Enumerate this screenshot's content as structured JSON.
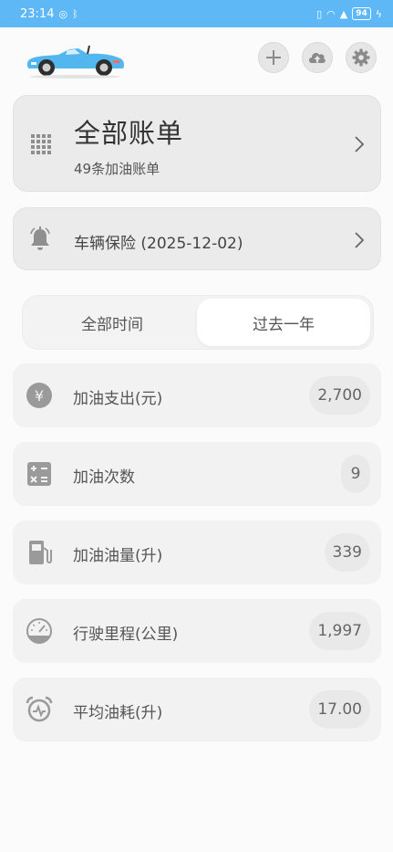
{
  "status_bar": {
    "time": "23:14",
    "battery": "94"
  },
  "header": {
    "logo_icon": "convertible-car-icon",
    "add_icon": "plus-icon",
    "upload_icon": "cloud-upload-icon",
    "settings_icon": "gear-icon"
  },
  "all_bills": {
    "title": "全部账单",
    "subtitle": "49条加油账单"
  },
  "insurance": {
    "label": "车辆保险 (2025-12-02)"
  },
  "tabs": {
    "all_time": "全部时间",
    "past_year": "过去一年",
    "selected": "past_year"
  },
  "stats": [
    {
      "label": "加油支出(元)",
      "value": "2,700",
      "icon": "yen-coin-icon"
    },
    {
      "label": "加油次数",
      "value": "9",
      "icon": "calculator-icon"
    },
    {
      "label": "加油油量(升)",
      "value": "339",
      "icon": "fuel-pump-icon"
    },
    {
      "label": "行驶里程(公里)",
      "value": "1,997",
      "icon": "speedometer-icon"
    },
    {
      "label": "平均油耗(升)",
      "value": "17.00",
      "icon": "alarm-clock-icon"
    }
  ],
  "colors": {
    "status_bar": "#5eb8f6",
    "car_body": "#52b6ef",
    "icon_gray": "#9a9a9a"
  }
}
